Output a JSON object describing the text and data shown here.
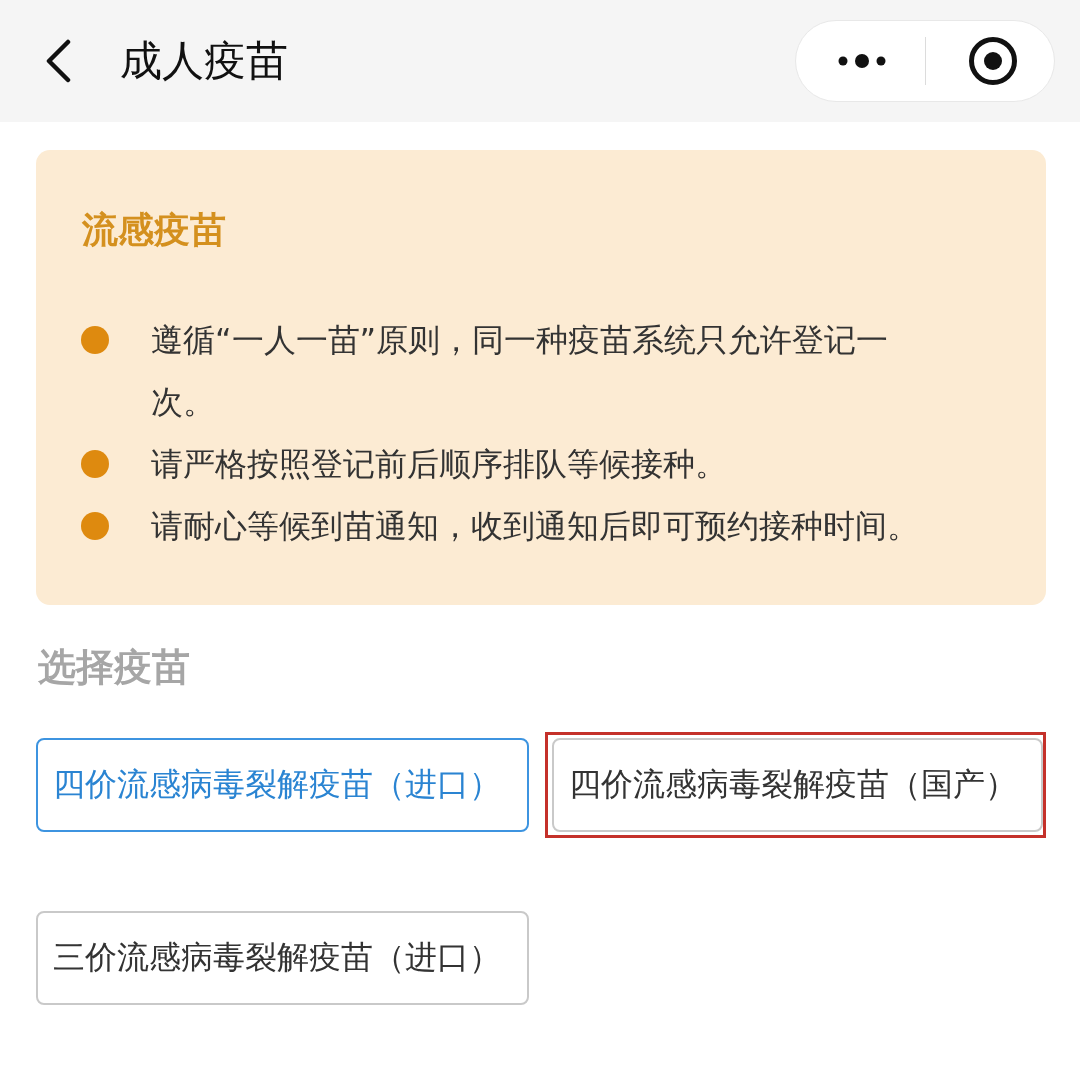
{
  "nav_bar": {
    "title": "成人疫苗"
  },
  "notice": {
    "title": "流感疫苗",
    "items": [
      "遵循“一人一苗”原则，同一种疫苗系统只允许登记一次。",
      "请严格按照登记前后顺序排队等候接种。",
      "请耐心等候到苗通知，收到通知后即可预约接种时间。"
    ]
  },
  "section": {
    "title": "选择疫苗"
  },
  "options": [
    {
      "label": "四价流感病毒裂解疫苗（进口）",
      "selected": true,
      "highlighted": false
    },
    {
      "label": "四价流感病毒裂解疫苗（国产）",
      "selected": false,
      "highlighted": true
    },
    {
      "label": "三价流感病毒裂解疫苗（进口）",
      "selected": false,
      "highlighted": false
    }
  ]
}
